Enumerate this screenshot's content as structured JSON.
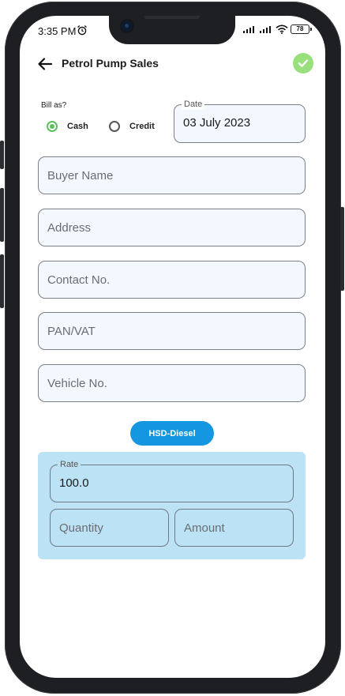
{
  "status_bar": {
    "time": "3:35 PM",
    "battery": "78"
  },
  "appbar": {
    "title": "Petrol Pump Sales"
  },
  "bill": {
    "label": "Bill as?",
    "options": [
      {
        "label": "Cash",
        "selected": true
      },
      {
        "label": "Credit",
        "selected": false
      }
    ]
  },
  "date_field": {
    "label": "Date",
    "value": "03 July 2023"
  },
  "form": {
    "buyer_name_placeholder": "Buyer Name",
    "address_placeholder": "Address",
    "contact_placeholder": "Contact No.",
    "pan_placeholder": "PAN/VAT",
    "vehicle_placeholder": "Vehicle No."
  },
  "fuel_chip": {
    "label": "HSD-Diesel"
  },
  "rate_section": {
    "rate_label": "Rate",
    "rate_value": "100.0",
    "quantity_placeholder": "Quantity",
    "amount_placeholder": "Amount"
  },
  "colors": {
    "accent_blue": "#1596e0",
    "panel_blue": "#bce2f5",
    "success_green": "#98e07c",
    "radio_green": "#5cbf5c"
  },
  "icons": {
    "back": "arrow-left-icon",
    "confirm": "check-circle-icon",
    "alarm": "alarm-icon",
    "signal": "signal-icon",
    "wifi": "wifi-icon",
    "battery": "battery-icon"
  }
}
